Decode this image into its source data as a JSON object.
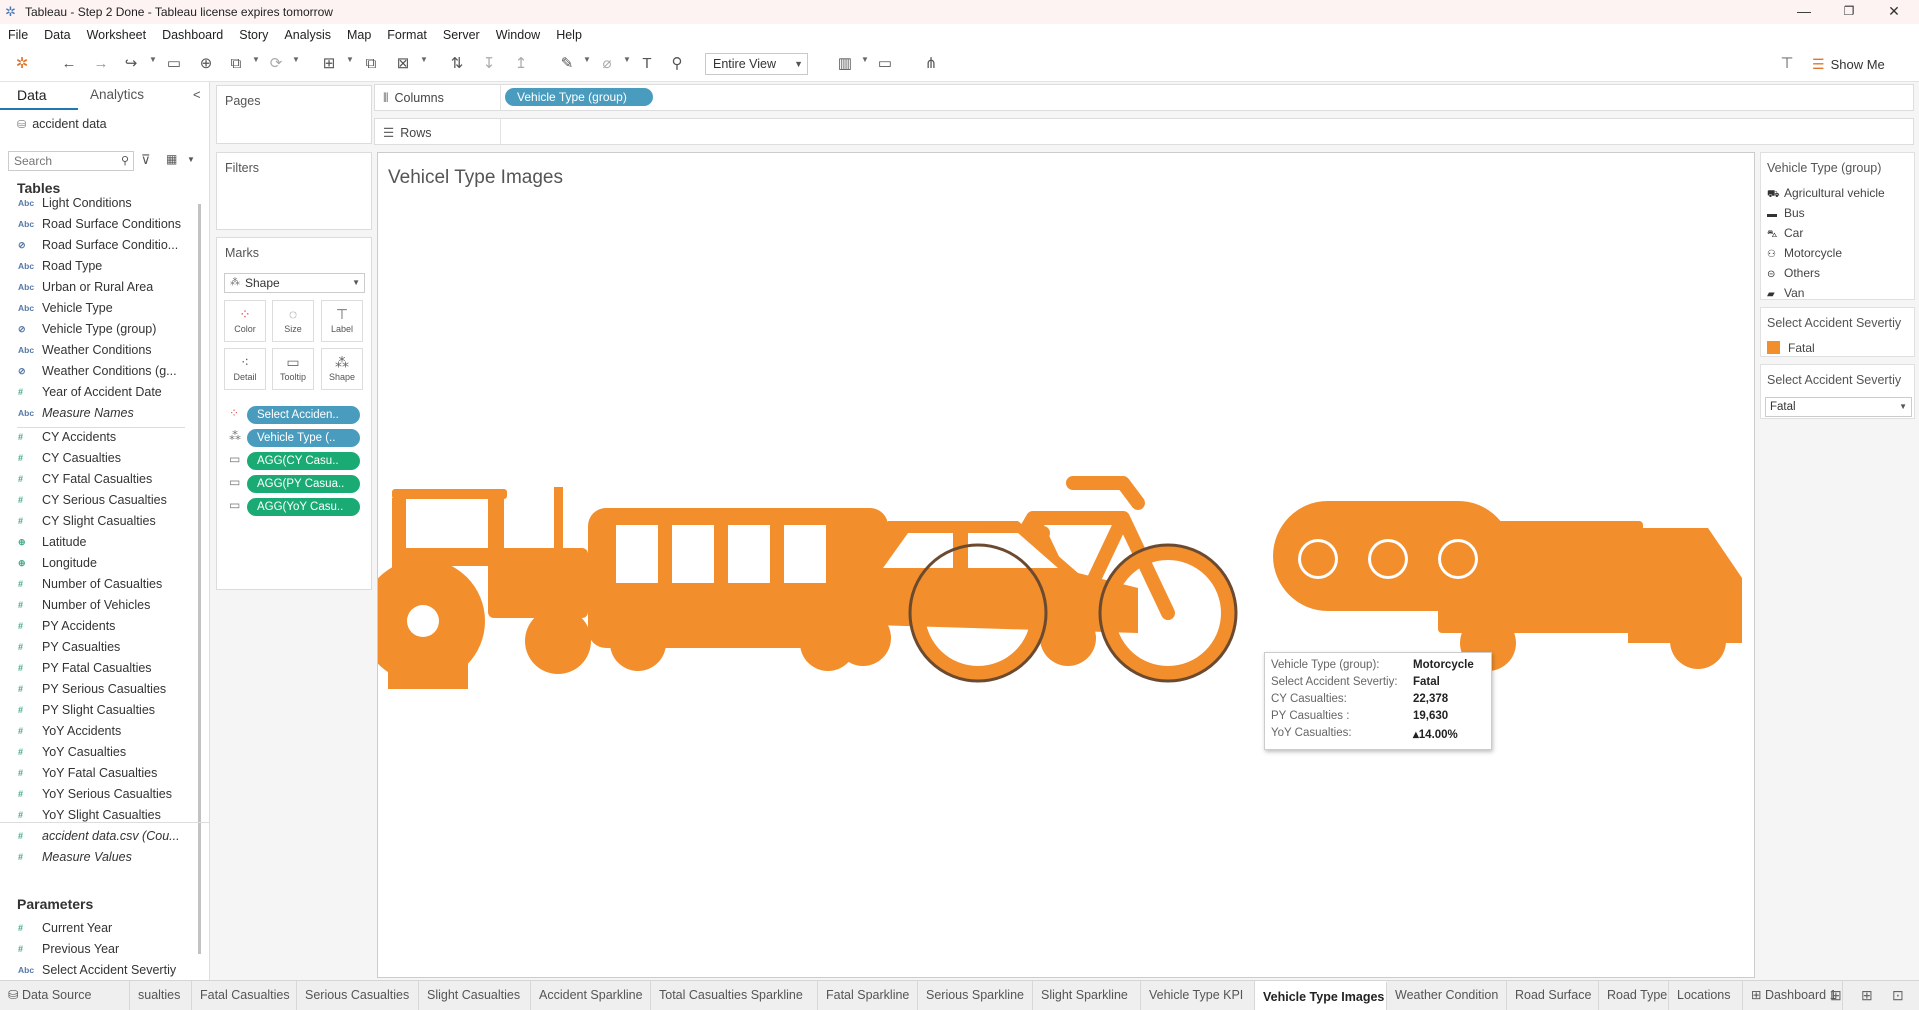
{
  "window": {
    "title": "Tableau - Step 2 Done - Tableau license expires tomorrow",
    "minimize": "—",
    "maximize": "❐",
    "close": "✕"
  },
  "menu": [
    "File",
    "Data",
    "Worksheet",
    "Dashboard",
    "Story",
    "Analysis",
    "Map",
    "Format",
    "Server",
    "Window",
    "Help"
  ],
  "toolbar": {
    "fit_dropdown": "Entire View",
    "show_me": "Show Me"
  },
  "data_pane": {
    "tab_data": "Data",
    "tab_analytics": "Analytics",
    "collapse": "<",
    "datasource": "accident data",
    "search_placeholder": "Search",
    "tables_header": "Tables",
    "fields": [
      {
        "name": "Light Conditions",
        "type": "abc"
      },
      {
        "name": "Road Surface Conditions",
        "type": "abc"
      },
      {
        "name": "Road Surface Conditio...",
        "type": "calc"
      },
      {
        "name": "Road Type",
        "type": "abc"
      },
      {
        "name": "Urban or Rural Area",
        "type": "abc"
      },
      {
        "name": "Vehicle Type",
        "type": "abc"
      },
      {
        "name": "Vehicle Type (group)",
        "type": "calc"
      },
      {
        "name": "Weather Conditions",
        "type": "abc"
      },
      {
        "name": "Weather Conditions (g...",
        "type": "calc"
      },
      {
        "name": "Year of Accident Date",
        "type": "num"
      },
      {
        "name": "Measure Names",
        "type": "abc",
        "italic": true
      },
      {
        "name": "CY Accidents",
        "type": "num"
      },
      {
        "name": "CY Casualties",
        "type": "num"
      },
      {
        "name": "CY Fatal Casualties",
        "type": "num"
      },
      {
        "name": "CY Serious Casualties",
        "type": "num"
      },
      {
        "name": "CY Slight Casualties",
        "type": "num"
      },
      {
        "name": "Latitude",
        "type": "geo"
      },
      {
        "name": "Longitude",
        "type": "geo"
      },
      {
        "name": "Number of Casualties",
        "type": "num"
      },
      {
        "name": "Number of Vehicles",
        "type": "num"
      },
      {
        "name": "PY Accidents",
        "type": "num"
      },
      {
        "name": "PY Casualties",
        "type": "num"
      },
      {
        "name": "PY Fatal Casualties",
        "type": "num"
      },
      {
        "name": "PY Serious Casualties",
        "type": "num"
      },
      {
        "name": "PY Slight Casualties",
        "type": "num"
      },
      {
        "name": "YoY Accidents",
        "type": "num"
      },
      {
        "name": "YoY Casualties",
        "type": "num"
      },
      {
        "name": "YoY Fatal Casualties",
        "type": "num"
      },
      {
        "name": "YoY Serious Casualties",
        "type": "num"
      },
      {
        "name": "YoY Slight Casualties",
        "type": "num"
      },
      {
        "name": "accident data.csv (Cou...",
        "type": "num",
        "italic": true
      },
      {
        "name": "Measure Values",
        "type": "num",
        "italic": true
      }
    ],
    "parameters_header": "Parameters",
    "parameters": [
      {
        "name": "Current Year",
        "type": "num"
      },
      {
        "name": "Previous Year",
        "type": "num"
      },
      {
        "name": "Select Accident Severtiy",
        "type": "abc"
      }
    ]
  },
  "shelves": {
    "pages": "Pages",
    "filters": "Filters",
    "marks": "Marks",
    "mark_type": "Shape",
    "mark_buttons": [
      "Color",
      "Size",
      "Label",
      "Detail",
      "Tooltip",
      "Shape"
    ],
    "mark_pills": [
      {
        "label": "Select Acciden..",
        "color": "blue"
      },
      {
        "label": "Vehicle Type (..",
        "color": "blue"
      },
      {
        "label": "AGG(CY Casu..",
        "color": "green"
      },
      {
        "label": "AGG(PY Casua..",
        "color": "green"
      },
      {
        "label": "AGG(YoY Casu..",
        "color": "green"
      }
    ],
    "columns_label": "Columns",
    "rows_label": "Rows",
    "columns_pill": "Vehicle Type (group)"
  },
  "viz": {
    "title": "Vehicel Type Images",
    "shape_color": "#f28e2b",
    "shapes": [
      "Agricultural vehicle",
      "Bus",
      "Car",
      "Motorcycle",
      "Others",
      "Van"
    ]
  },
  "tooltip": {
    "rows": [
      {
        "key": "Vehicle Type (group):",
        "value": "Motorcycle"
      },
      {
        "key": "Select Accident Severtiy:",
        "value": "Fatal"
      },
      {
        "key": "CY Casualties:",
        "value": "22,378"
      },
      {
        "key": "PY Casualties :",
        "value": "19,630"
      },
      {
        "key": "YoY Casualties:",
        "value": "▴14.00%"
      }
    ]
  },
  "legend": {
    "shape_title": "Vehicle Type (group)",
    "shape_items": [
      "Agricultural vehicle",
      "Bus",
      "Car",
      "Motorcycle",
      "Others",
      "Van"
    ],
    "color_title": "Select Accident Severtiy",
    "color_item": "Fatal",
    "color_swatch": "#f28e2b",
    "param_title": "Select Accident Severtiy",
    "param_value": "Fatal"
  },
  "bottom_tabs": [
    {
      "label": "Data Source"
    },
    {
      "label": "sualties"
    },
    {
      "label": "Fatal Casualties"
    },
    {
      "label": "Serious Casualties"
    },
    {
      "label": "Slight Casualties"
    },
    {
      "label": "Accident Sparkline"
    },
    {
      "label": "Total Casualties Sparkline"
    },
    {
      "label": "Fatal Sparkline"
    },
    {
      "label": "Serious Sparkline"
    },
    {
      "label": "Slight Sparkline"
    },
    {
      "label": "Vehicle Type KPI"
    },
    {
      "label": "Vehicle Type Images",
      "active": true
    },
    {
      "label": "Weather Condition"
    },
    {
      "label": "Road Surface"
    },
    {
      "label": "Road Type"
    },
    {
      "label": "Locations"
    },
    {
      "label": "Dashboard 1"
    }
  ]
}
